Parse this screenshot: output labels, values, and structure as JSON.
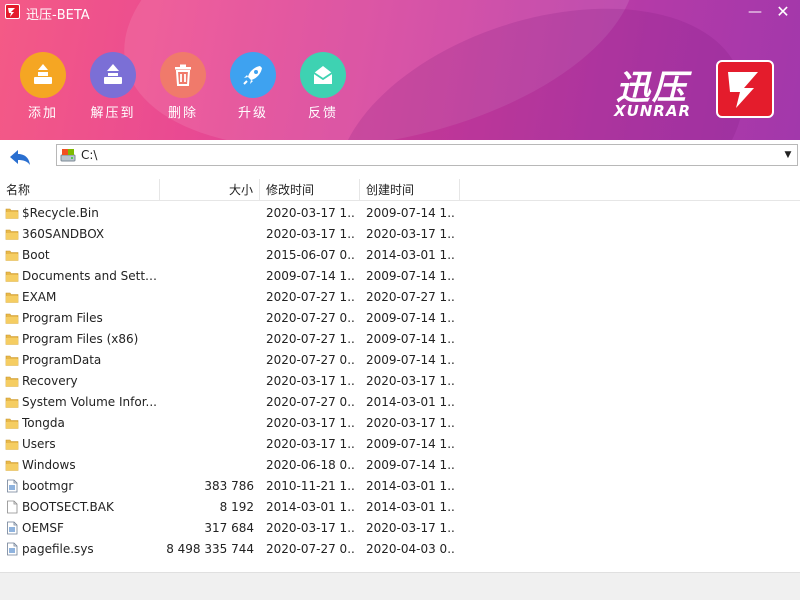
{
  "window": {
    "title": "迅压-BETA",
    "minimize_label": "—",
    "close_label": "✕"
  },
  "toolbar": [
    {
      "label": "添加",
      "color": "#f5a623",
      "icon": "add-archive-icon"
    },
    {
      "label": "解压到",
      "color": "#7b6fd6",
      "icon": "extract-icon"
    },
    {
      "label": "删除",
      "color": "#f07a6b",
      "icon": "trash-icon"
    },
    {
      "label": "升级",
      "color": "#3ea2f0",
      "icon": "rocket-icon"
    },
    {
      "label": "反馈",
      "color": "#3ed2b2",
      "icon": "mail-icon"
    }
  ],
  "brand": {
    "cn": "迅压",
    "en": "XUNRAR",
    "color": "#e41c2c"
  },
  "address": {
    "path": "C:\\"
  },
  "columns": {
    "name": "名称",
    "size": "大小",
    "modified": "修改时间",
    "created": "创建时间"
  },
  "files": [
    {
      "name": "$Recycle.Bin",
      "size": "",
      "modified": "2020-03-17 1...",
      "created": "2009-07-14 1...",
      "type": "folder"
    },
    {
      "name": "360SANDBOX",
      "size": "",
      "modified": "2020-03-17 1...",
      "created": "2020-03-17 1...",
      "type": "folder"
    },
    {
      "name": "Boot",
      "size": "",
      "modified": "2015-06-07 0...",
      "created": "2014-03-01 1...",
      "type": "folder"
    },
    {
      "name": "Documents and Settin...",
      "size": "",
      "modified": "2009-07-14 1...",
      "created": "2009-07-14 1...",
      "type": "folder"
    },
    {
      "name": "EXAM",
      "size": "",
      "modified": "2020-07-27 1...",
      "created": "2020-07-27 1...",
      "type": "folder"
    },
    {
      "name": "Program Files",
      "size": "",
      "modified": "2020-07-27 0...",
      "created": "2009-07-14 1...",
      "type": "folder"
    },
    {
      "name": "Program Files (x86)",
      "size": "",
      "modified": "2020-07-27 1...",
      "created": "2009-07-14 1...",
      "type": "folder"
    },
    {
      "name": "ProgramData",
      "size": "",
      "modified": "2020-07-27 0...",
      "created": "2009-07-14 1...",
      "type": "folder"
    },
    {
      "name": "Recovery",
      "size": "",
      "modified": "2020-03-17 1...",
      "created": "2020-03-17 1...",
      "type": "folder"
    },
    {
      "name": "System Volume Infor...",
      "size": "",
      "modified": "2020-07-27 0...",
      "created": "2014-03-01 1...",
      "type": "folder"
    },
    {
      "name": "Tongda",
      "size": "",
      "modified": "2020-03-17 1...",
      "created": "2020-03-17 1...",
      "type": "folder"
    },
    {
      "name": "Users",
      "size": "",
      "modified": "2020-03-17 1...",
      "created": "2009-07-14 1...",
      "type": "folder"
    },
    {
      "name": "Windows",
      "size": "",
      "modified": "2020-06-18 0...",
      "created": "2009-07-14 1...",
      "type": "folder"
    },
    {
      "name": "bootmgr",
      "size": "383 786",
      "modified": "2010-11-21 1...",
      "created": "2014-03-01 1...",
      "type": "sysfile"
    },
    {
      "name": "BOOTSECT.BAK",
      "size": "8 192",
      "modified": "2014-03-01 1...",
      "created": "2014-03-01 1...",
      "type": "file"
    },
    {
      "name": "OEMSF",
      "size": "317 684",
      "modified": "2020-03-17 1...",
      "created": "2020-03-17 1...",
      "type": "sysfile"
    },
    {
      "name": "pagefile.sys",
      "size": "8 498 335 744",
      "modified": "2020-07-27 0...",
      "created": "2020-04-03 0...",
      "type": "sysfile"
    }
  ]
}
